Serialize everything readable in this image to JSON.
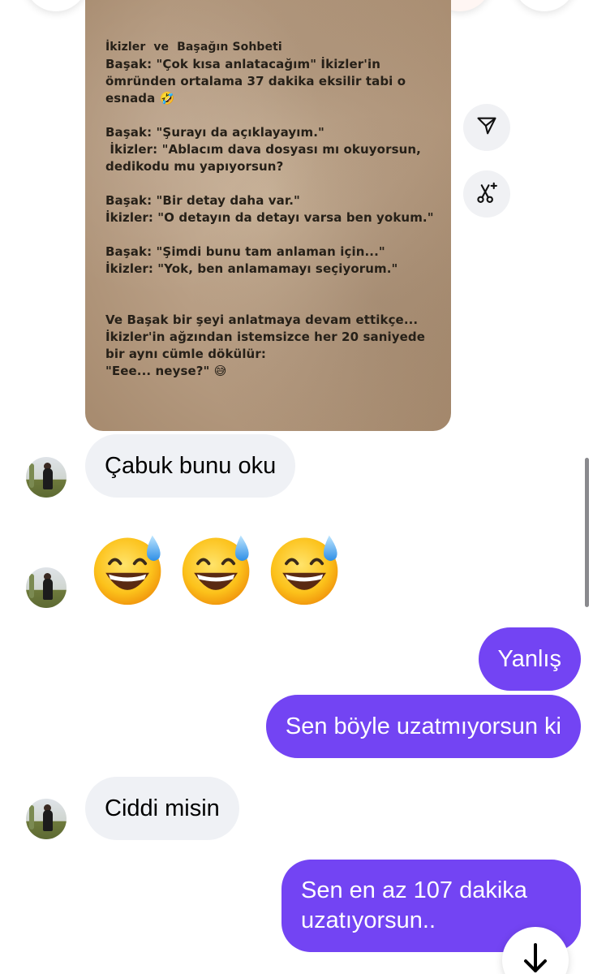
{
  "shared_image": {
    "lines": [
      "İkizler  ve  Başağın Sohbeti",
      "Başak: \"Çok kısa anlatacağım\" İkizler'in",
      "ömründen ortalama 37 dakika eksilir tabi o",
      "esnada 🤣",
      "",
      "Başak: \"Şurayı da açıklayayım.\"",
      " İkizler: \"Ablacım dava dosyası mı okuyorsun,",
      "dedikodu mu yapıyorsun?",
      "",
      "Başak: \"Bir detay daha var.\"",
      "İkizler: \"O detayın da detayı varsa ben yokum.\"",
      "",
      "Başak: \"Şimdi bunu tam anlaman için...\"",
      "İkizler: \"Yok, ben anlamamayı seçiyorum.\"",
      "",
      "",
      "Ve Başak bir şeyi anlatmaya devam ettikçe...",
      "İkizler'in ağzından istemsizce her 20 saniyede",
      "bir aynı cümle dökülür:",
      "\"Eee... neyse?\" 😅"
    ]
  },
  "side_actions": {
    "share_icon": "send-icon",
    "ai_icon": "sparkle-scissors-icon"
  },
  "messages": {
    "m1": "Çabuk bunu oku",
    "m2_emoji": "😅 😅 😅",
    "m3": "Yanlış",
    "m4": "Sen böyle uzatmıyorsun ki",
    "m5": "Ciddi misin",
    "m6_line1": "Sen en az 107 dakika",
    "m6_line2": "uzatıyorsun.."
  },
  "colors": {
    "outgoing": "#7344f3",
    "incoming": "#eff1f5"
  },
  "scroll_down_icon": "arrow-down-icon"
}
